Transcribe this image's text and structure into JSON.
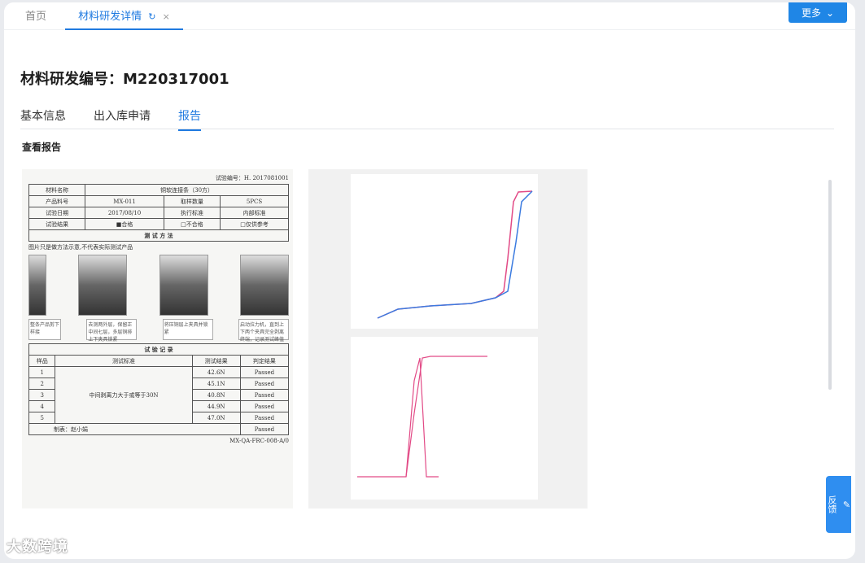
{
  "tabbar": {
    "home": "首页",
    "active": "材料研发详情",
    "more": "更多"
  },
  "page": {
    "title": "材料研发编号：M220317001",
    "section": "查看报告"
  },
  "subtabs": [
    "基本信息",
    "出入库申请",
    "报告"
  ],
  "feedback": "反馈",
  "watermark": "大数跨境",
  "report": {
    "test_no": "试验编号：H. 2017081001",
    "rows": [
      [
        "材料名称",
        "铜软连接条（30方）",
        "",
        ""
      ],
      [
        "产品料号",
        "MX-011",
        "取样数量",
        "5PCS"
      ],
      [
        "试验日期",
        "2017/08/10",
        "执行标准",
        "内部标准"
      ],
      [
        "试验结果",
        "■合格",
        "□不合格",
        "□仅供参考"
      ]
    ],
    "method": "测 试 方 法",
    "img_note": "图片只是做方法示意,不代表实际测试产品",
    "notes": [
      "整条产品剪下样接",
      "去测两外层，保留正中间七层，多层铜排上下夹具锁紧",
      "将压铜层上夹具并锁紧",
      "启动拉力机，直到上下两个夹具完全剥离终端，记录测试峰值"
    ],
    "record": "试 验 记 录",
    "headers": [
      "样品",
      "测试标准",
      "测试结果",
      "判定结果"
    ],
    "standard": "中间剥离力大于或等于30N",
    "results": [
      [
        "1",
        "42.6N",
        "Passed"
      ],
      [
        "2",
        "45.1N",
        "Passed"
      ],
      [
        "3",
        "40.8N",
        "Passed"
      ],
      [
        "4",
        "44.9N",
        "Passed"
      ],
      [
        "5",
        "47.0N",
        "Passed"
      ]
    ],
    "footer": "制表：赵小娟",
    "code": "MX-QA-FRC-008-A/0"
  }
}
